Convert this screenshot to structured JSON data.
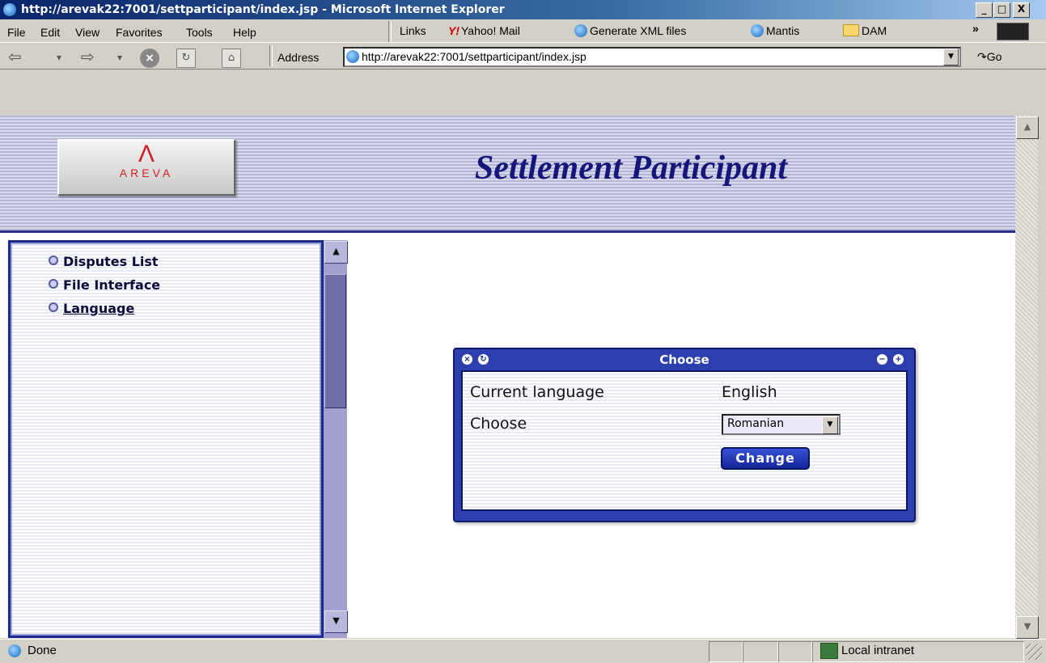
{
  "window": {
    "title": "http://arevak22:7001/settparticipant/index.jsp - Microsoft Internet Explorer",
    "minimize": "_",
    "maximize": "□",
    "close": "X"
  },
  "menu": {
    "file": "File",
    "edit": "Edit",
    "view": "View",
    "favorites": "Favorites",
    "tools": "Tools",
    "help": "Help"
  },
  "links": {
    "label": "Links",
    "yahoo": "Yahoo! Mail",
    "generate_xml": "Generate XML files",
    "mantis": "Mantis",
    "dam": "DAM",
    "more": "»"
  },
  "toolbar": {
    "address_label": "Address",
    "address_value": "http://arevak22:7001/settparticipant/index.jsp",
    "go_label": "Go"
  },
  "page": {
    "logo_text": "AREVA",
    "title": "Settlement Participant"
  },
  "nav": {
    "items": [
      {
        "label": "Disputes List"
      },
      {
        "label": "File Interface"
      },
      {
        "label": "Language"
      }
    ]
  },
  "dialog": {
    "title": "Choose",
    "current_language_label": "Current language",
    "current_language_value": "English",
    "choose_label": "Choose",
    "selected_language": "Romanian",
    "change_button": "Change"
  },
  "status": {
    "text": "Done",
    "zone": "Local intranet"
  },
  "colors": {
    "accent": "#2d3fae",
    "title_text": "#15157a",
    "logo_red": "#d31f26"
  }
}
